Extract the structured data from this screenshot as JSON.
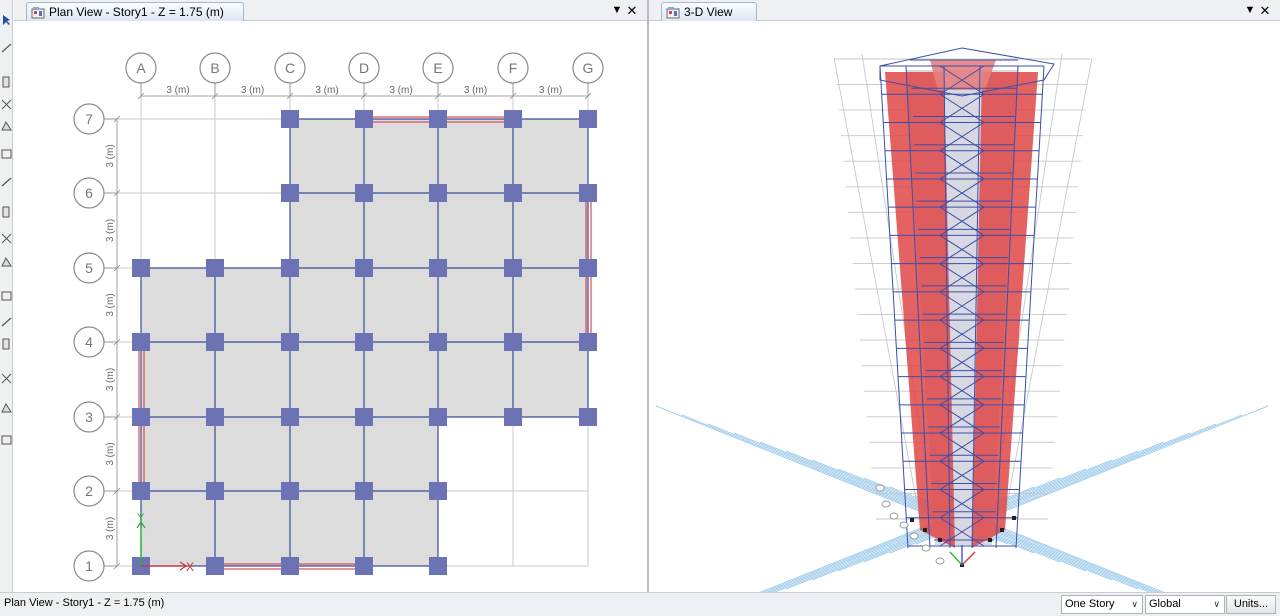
{
  "left_tab": {
    "title": "Plan View - Story1 - Z = 1.75 (m)",
    "pin_glyph": "▼",
    "close_glyph": "✕",
    "icon": "plan-view-icon"
  },
  "right_tab": {
    "title": "3-D View",
    "pin_glyph": "▼",
    "close_glyph": "✕",
    "icon": "3d-view-icon"
  },
  "plan": {
    "grid_x": [
      "A",
      "B",
      "C",
      "D",
      "E",
      "F",
      "G"
    ],
    "grid_y": [
      "7",
      "6",
      "5",
      "4",
      "3",
      "2",
      "1"
    ],
    "x_spacing_label": "3 (m)",
    "y_spacing_label": "3 (m)",
    "axis_x_label": "X",
    "axis_y_label": "Y"
  },
  "status": {
    "text": "Plan View - Story1 - Z = 1.75 (m)",
    "story_combo": "One Story",
    "coord_combo": "Global",
    "units_button": "Units..."
  },
  "toolbar_icons": [
    "pointer-icon",
    "reshape-icon",
    "draw-line-icon",
    "draw-beam-icon",
    "draw-column-icon",
    "draw-brace-icon",
    "draw-slab-icon",
    "draw-wall-icon",
    "draw-opening-icon",
    "draw-point-icon",
    "draw-link-icon",
    "draw-section-cut-icon",
    "draw-dimension-icon",
    "draw-grid-icon",
    "draw-area-icon",
    "snap-icon"
  ],
  "colors": {
    "grid_line": "#c9c9c9",
    "beam": "#3a4b9c",
    "column": "#6b73b5",
    "slab": "#dcdcdc",
    "wall": "#d62b2b",
    "axis_x": "#e03030",
    "axis_y": "#22bb22"
  }
}
